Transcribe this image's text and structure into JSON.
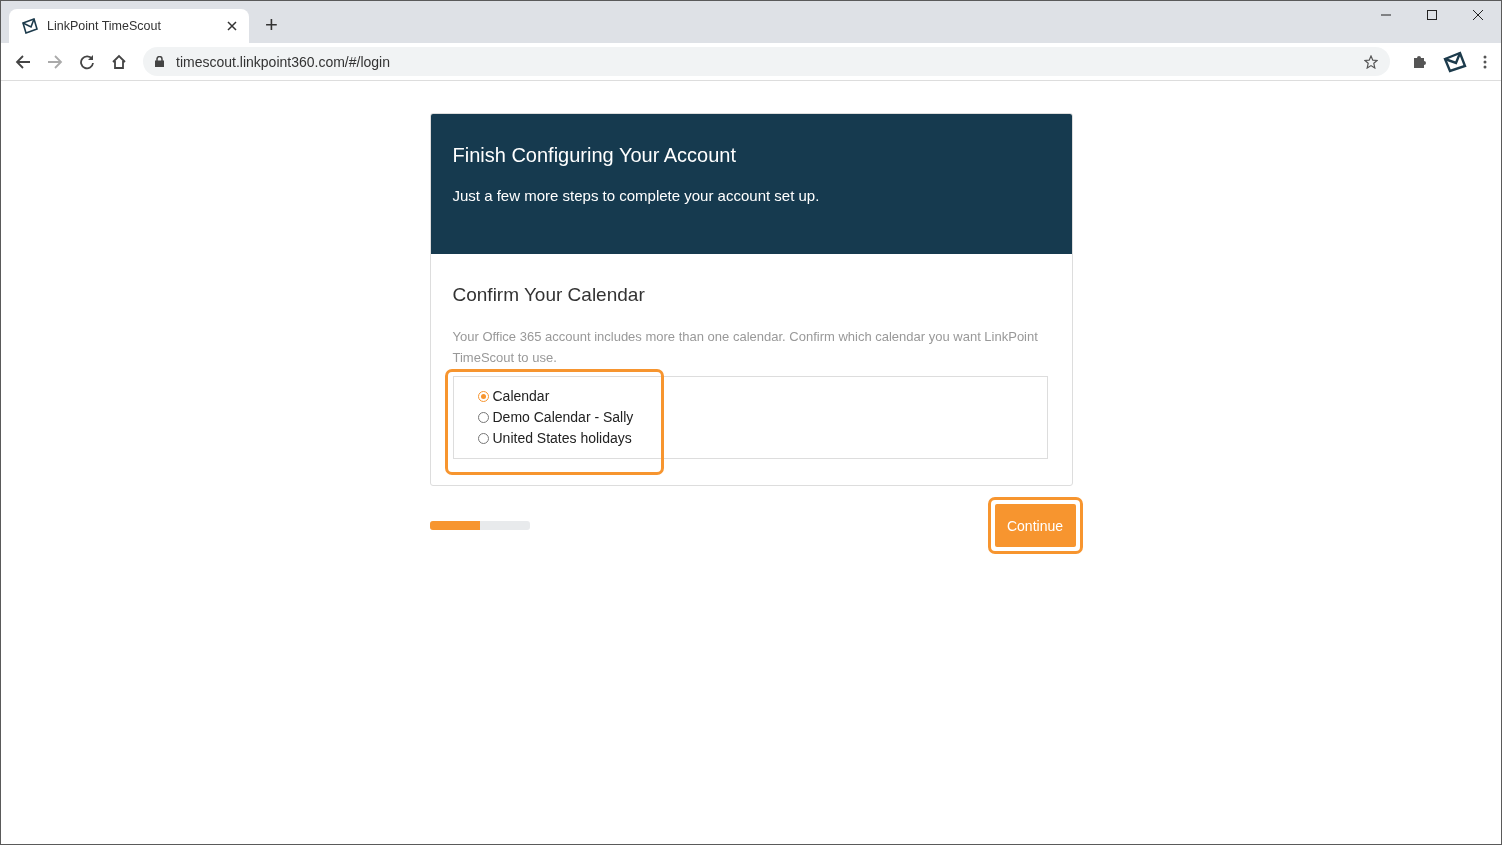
{
  "browser": {
    "tabs": [
      {
        "title": "LinkPoint TimeScout",
        "selected": true
      }
    ],
    "new_tab": "+",
    "url": "timescout.linkpoint360.com/#/login"
  },
  "header": {
    "title": "Finish Configuring Your Account",
    "subtitle": "Just a few more steps to complete your account set up."
  },
  "section": {
    "title": "Confirm Your Calendar",
    "description": "Your Office 365 account includes more than one calendar. Confirm which calendar you want LinkPoint TimeScout to use.",
    "calendars": [
      {
        "label": "Calendar",
        "selected": true
      },
      {
        "label": "Demo Calendar - Sally",
        "selected": false
      },
      {
        "label": "United States holidays",
        "selected": false
      }
    ]
  },
  "progress": {
    "level": 0.5
  },
  "continue_button": "Continue"
}
